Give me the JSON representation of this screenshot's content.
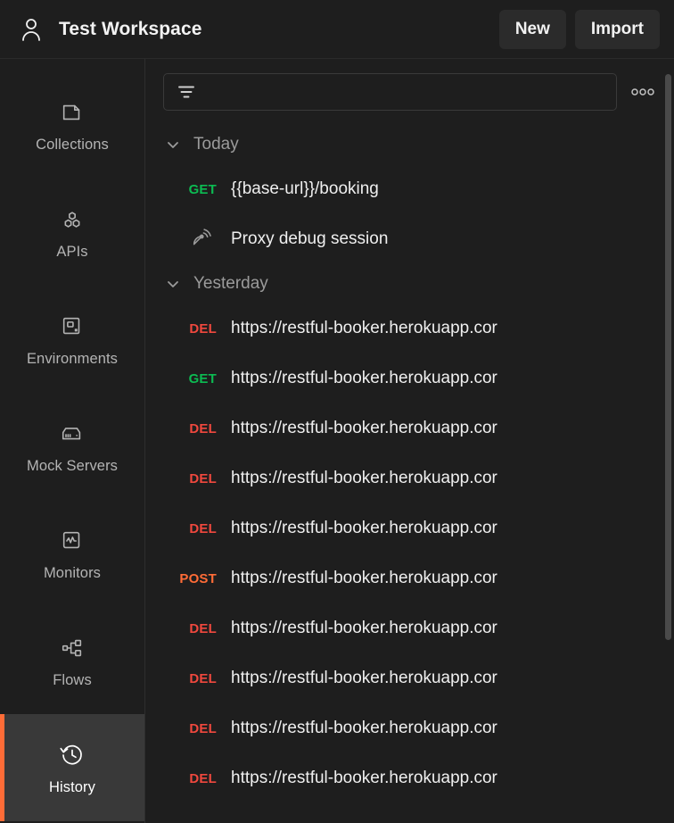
{
  "header": {
    "avatar_icon": "person-icon",
    "workspace_title": "Test Workspace",
    "new_label": "New",
    "import_label": "Import"
  },
  "sidebar": {
    "items": [
      {
        "label": "Collections",
        "icon": "collections-folder-icon",
        "active": false
      },
      {
        "label": "APIs",
        "icon": "apis-hexagons-icon",
        "active": false
      },
      {
        "label": "Environments",
        "icon": "environments-square-icon",
        "active": false
      },
      {
        "label": "Mock Servers",
        "icon": "mock-servers-icon",
        "active": false
      },
      {
        "label": "Monitors",
        "icon": "monitors-pulse-icon",
        "active": false
      },
      {
        "label": "Flows",
        "icon": "flows-nodes-icon",
        "active": false
      },
      {
        "label": "History",
        "icon": "history-clock-icon",
        "active": true
      }
    ],
    "active_indicator_color": "#ff6c37"
  },
  "toolbar": {
    "filter_icon": "filter-funnel-icon",
    "filter_value": "",
    "filter_placeholder": "",
    "more_icon": "more-options-icon"
  },
  "colors": {
    "get": "#0cbb52",
    "delete": "#f0483e",
    "post": "#ff6c37",
    "accent": "#ff6c37",
    "background": "#1e1e1e",
    "active_nav": "#393939"
  },
  "history": {
    "groups": [
      {
        "title": "Today",
        "expanded": true,
        "chevron_icon": "chevron-down-icon",
        "rows": [
          {
            "kind": "request",
            "method": "GET",
            "method_color": "#0cbb52",
            "label": "{{base-url}}/booking"
          },
          {
            "kind": "proxy",
            "icon": "satellite-dish-icon",
            "label": "Proxy debug session"
          }
        ]
      },
      {
        "title": "Yesterday",
        "expanded": true,
        "chevron_icon": "chevron-down-icon",
        "rows": [
          {
            "kind": "request",
            "method": "DEL",
            "method_color": "#f0483e",
            "label": "https://restful-booker.herokuapp.cor"
          },
          {
            "kind": "request",
            "method": "GET",
            "method_color": "#0cbb52",
            "label": "https://restful-booker.herokuapp.cor"
          },
          {
            "kind": "request",
            "method": "DEL",
            "method_color": "#f0483e",
            "label": "https://restful-booker.herokuapp.cor"
          },
          {
            "kind": "request",
            "method": "DEL",
            "method_color": "#f0483e",
            "label": "https://restful-booker.herokuapp.cor"
          },
          {
            "kind": "request",
            "method": "DEL",
            "method_color": "#f0483e",
            "label": "https://restful-booker.herokuapp.cor"
          },
          {
            "kind": "request",
            "method": "POST",
            "method_color": "#ff6c37",
            "label": "https://restful-booker.herokuapp.cor"
          },
          {
            "kind": "request",
            "method": "DEL",
            "method_color": "#f0483e",
            "label": "https://restful-booker.herokuapp.cor"
          },
          {
            "kind": "request",
            "method": "DEL",
            "method_color": "#f0483e",
            "label": "https://restful-booker.herokuapp.cor"
          },
          {
            "kind": "request",
            "method": "DEL",
            "method_color": "#f0483e",
            "label": "https://restful-booker.herokuapp.cor"
          },
          {
            "kind": "request",
            "method": "DEL",
            "method_color": "#f0483e",
            "label": "https://restful-booker.herokuapp.cor"
          }
        ]
      }
    ]
  },
  "scrollbar": {
    "thumb_top_pct": 2,
    "thumb_height_pct": 74
  }
}
